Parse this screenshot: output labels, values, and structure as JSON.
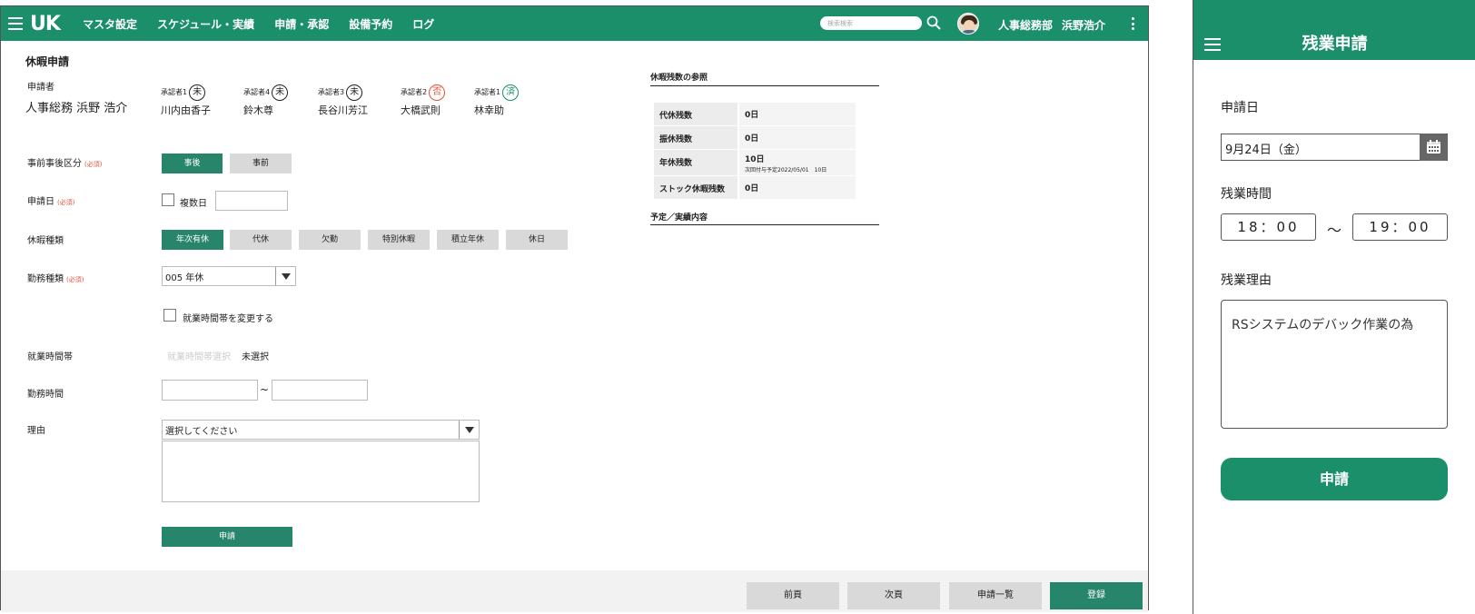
{
  "app": {
    "logo": "UK",
    "nav": [
      "マスタ設定",
      "スケジュール・実績",
      "申請・承認",
      "設備予約",
      "ログ"
    ],
    "search_placeholder": "検索検索",
    "department": "人事総務部",
    "user_name": "浜野浩介"
  },
  "form": {
    "title": "休暇申請",
    "applicant_label": "申請者",
    "applicant_name": "人事総務 浜野 浩介",
    "approvers": [
      {
        "role": "承認者1",
        "stamp": "未",
        "name": "川内由香子",
        "color": "#222222"
      },
      {
        "role": "承認者4",
        "stamp": "未",
        "name": "鈴木尊",
        "color": "#222222"
      },
      {
        "role": "承認者3",
        "stamp": "未",
        "name": "長谷川芳江",
        "color": "#222222"
      },
      {
        "role": "承認者2",
        "stamp": "否",
        "name": "大橋武則",
        "color": "#e0533a"
      },
      {
        "role": "承認者1",
        "stamp": "済",
        "name": "林幸助",
        "color": "#1a8f6a"
      }
    ],
    "required_mark": "(必須)",
    "timing_label": "事前事後区分",
    "timing_options": [
      "事後",
      "事前"
    ],
    "timing_selected": "事後",
    "date_label": "申請日",
    "multi_day_label": "複数日",
    "leave_type_label": "休暇種類",
    "leave_types": [
      "年次有休",
      "代休",
      "欠勤",
      "特別休暇",
      "積立年休",
      "休日"
    ],
    "leave_type_selected": "年次有休",
    "work_type_label": "勤務種類",
    "work_type_value": "005 年休",
    "change_band_label": "就業時間帯を変更する",
    "band_label": "就業時間帯",
    "band_placeholder": "就業時間帯選択",
    "band_value": "未選択",
    "hours_label": "勤務時間",
    "hours_sep": "~",
    "reason_label": "理由",
    "reason_select": "選択してください",
    "submit": "申請"
  },
  "side": {
    "balance_title": "休暇残数の参照",
    "balances": [
      {
        "k": "代休残数",
        "v": "0日",
        "sub": ""
      },
      {
        "k": "振休残数",
        "v": "0日",
        "sub": ""
      },
      {
        "k": "年休残数",
        "v": "10日",
        "sub": "次回付与予定2022/05/01　10日"
      },
      {
        "k": "ストック休暇残数",
        "v": "0日",
        "sub": ""
      }
    ],
    "plan_title": "予定／実績内容"
  },
  "footer": {
    "prev": "前頁",
    "next": "次頁",
    "list": "申請一覧",
    "register": "登録"
  },
  "mobile": {
    "title": "残業申請",
    "date_label": "申請日",
    "date_value": "9月24日（金）",
    "time_label": "残業時間",
    "start": "18：00",
    "tilde": "～",
    "end": "19：00",
    "reason_label": "残業理由",
    "reason_value": "RSシステムのデバック作業の為",
    "submit": "申請"
  }
}
